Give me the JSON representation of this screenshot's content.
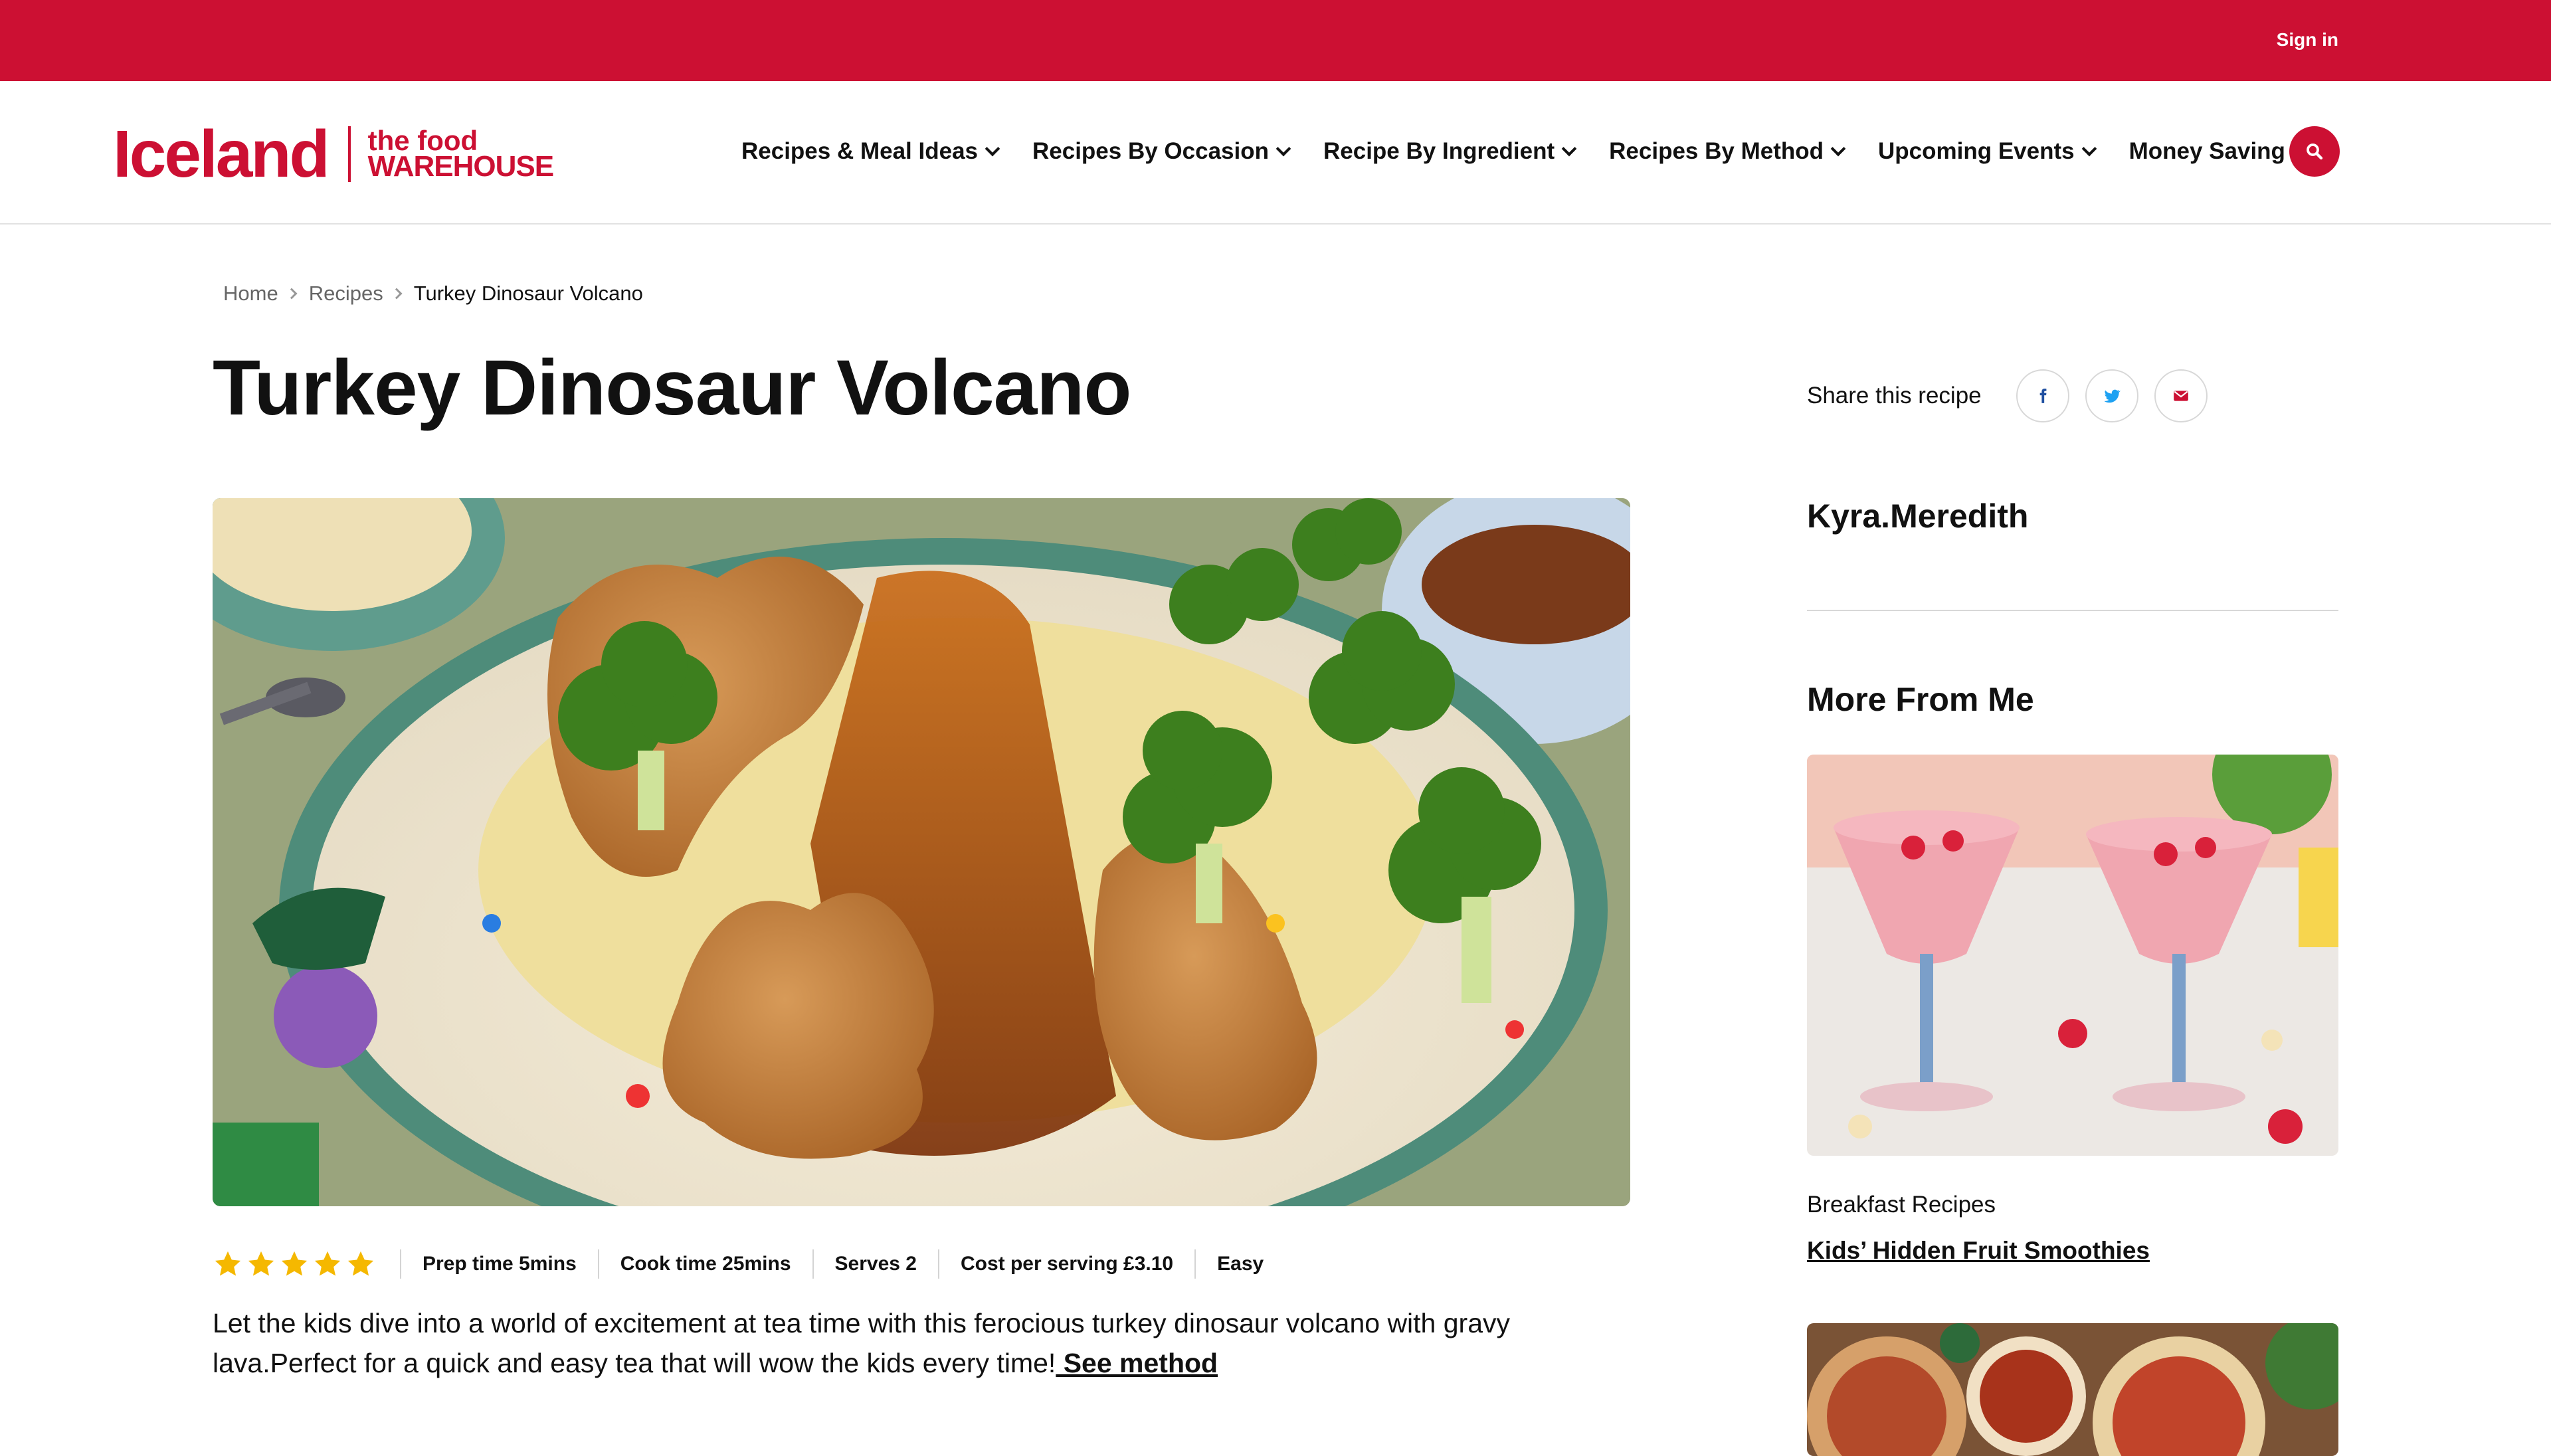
{
  "topbar": {
    "sign_in": "Sign in"
  },
  "brand": {
    "name": "Iceland",
    "sub_line1": "the food",
    "sub_line2": "WAREHOUSE",
    "color": "#cc1033"
  },
  "nav": {
    "items": [
      {
        "label": "Recipes & Meal Ideas",
        "dropdown": true
      },
      {
        "label": "Recipes By Occasion",
        "dropdown": true
      },
      {
        "label": "Recipe By Ingredient",
        "dropdown": true
      },
      {
        "label": "Recipes By Method",
        "dropdown": true
      },
      {
        "label": "Upcoming Events",
        "dropdown": true
      },
      {
        "label": "Money Saving Tips",
        "dropdown": false
      }
    ],
    "search_icon": "search-icon"
  },
  "breadcrumb": {
    "items": [
      "Home",
      "Recipes"
    ],
    "current": "Turkey Dinosaur Volcano"
  },
  "recipe": {
    "title": "Turkey Dinosaur Volcano",
    "rating": 5,
    "prep_time": "Prep time 5mins",
    "cook_time": "Cook time 25mins",
    "serves": "Serves 2",
    "cost": "Cost per serving £3.10",
    "difficulty": "Easy",
    "description": "Let the kids dive into a world of excitement at tea time with this ferocious turkey dinosaur volcano with gravy lava.Perfect for a quick and easy tea that will wow the kids every time!",
    "see_method": " See method"
  },
  "share": {
    "label": "Share this recipe",
    "buttons": [
      "facebook-icon",
      "twitter-icon",
      "mail-icon"
    ]
  },
  "author": {
    "name": "Kyra.Meredith"
  },
  "more_from_me": {
    "title": "More From Me",
    "cards": [
      {
        "category": "Breakfast Recipes",
        "title": "Kids’ Hidden Fruit Smoothies"
      }
    ]
  },
  "colors": {
    "accent": "#cc1033",
    "star": "#f5b800",
    "twitter": "#1da1f2",
    "facebook": "#1f4fa0"
  }
}
